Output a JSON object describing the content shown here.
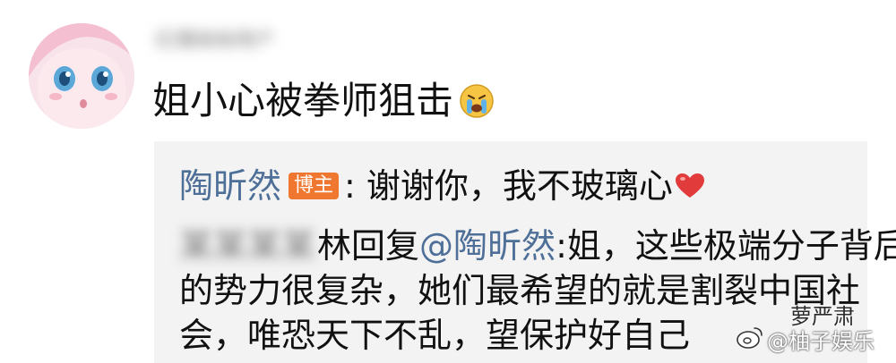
{
  "comment": {
    "username": "红猪妹妹用户",
    "text": "姐小心被拳师狙击",
    "emoji": "crying-face-icon"
  },
  "reply": {
    "author": "陶昕然",
    "badge": "博主",
    "author_text": ": 谢谢你，我不玻璃心",
    "heart": "heart-icon",
    "replier_blurred": "某某某某",
    "replier_suffix": "林",
    "reply_word": "回复",
    "mention": "@陶昕然",
    "body_line1": ":姐，这些极端分子背后",
    "body_line2": "的势力很复杂，她们最希望的就是割裂中国社",
    "body_line3": "会，唯恐天下不乱，望保护好自己"
  },
  "watermark": {
    "top": "萝严肃",
    "bottom": "@柚子娱乐"
  },
  "colors": {
    "link": "#4e6f98",
    "badge": "#f0772f",
    "reply_bg": "#f3f3f3",
    "heart": "#e23b3b"
  }
}
